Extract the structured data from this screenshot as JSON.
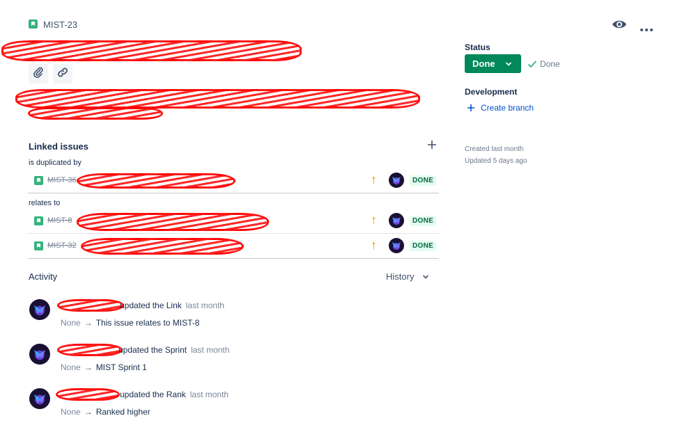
{
  "header": {
    "issue_key": "MIST-23",
    "watch_icon": "eye-icon",
    "more_icon": "more-horizontal-icon"
  },
  "toolbar": {
    "attach_icon": "paperclip-icon",
    "link_icon": "link-icon"
  },
  "linked_issues": {
    "title": "Linked issues",
    "add_icon": "plus-icon",
    "groups": [
      {
        "label": "is duplicated by",
        "issues": [
          {
            "key": "MIST-36",
            "status": "DONE",
            "priority": "high"
          }
        ]
      },
      {
        "label": "relates to",
        "issues": [
          {
            "key": "MIST-8",
            "status": "DONE",
            "priority": "high"
          },
          {
            "key": "MIST-32",
            "status": "DONE",
            "priority": "high"
          }
        ]
      }
    ]
  },
  "activity": {
    "title": "Activity",
    "filter_label": "History",
    "items": [
      {
        "action": "updated the Link",
        "time": "last month",
        "from": "None",
        "to": "This issue relates to MIST-8"
      },
      {
        "action": "updated the Sprint",
        "time": "last month",
        "from": "None",
        "to": "MIST Sprint 1"
      },
      {
        "action": "updated the Rank",
        "time": "last month",
        "from": "None",
        "to": "Ranked higher"
      }
    ]
  },
  "sidebar": {
    "status_label": "Status",
    "status_button": "Done",
    "resolution": "Done",
    "development_label": "Development",
    "create_branch": "Create branch",
    "created": "Created last month",
    "updated": "Updated 5 days ago"
  },
  "colors": {
    "status_green": "#00875a",
    "link_blue": "#0052cc",
    "priority_orange": "#ff8b00",
    "done_lozenge_bg": "#e3fcef",
    "done_lozenge_text": "#006644"
  }
}
